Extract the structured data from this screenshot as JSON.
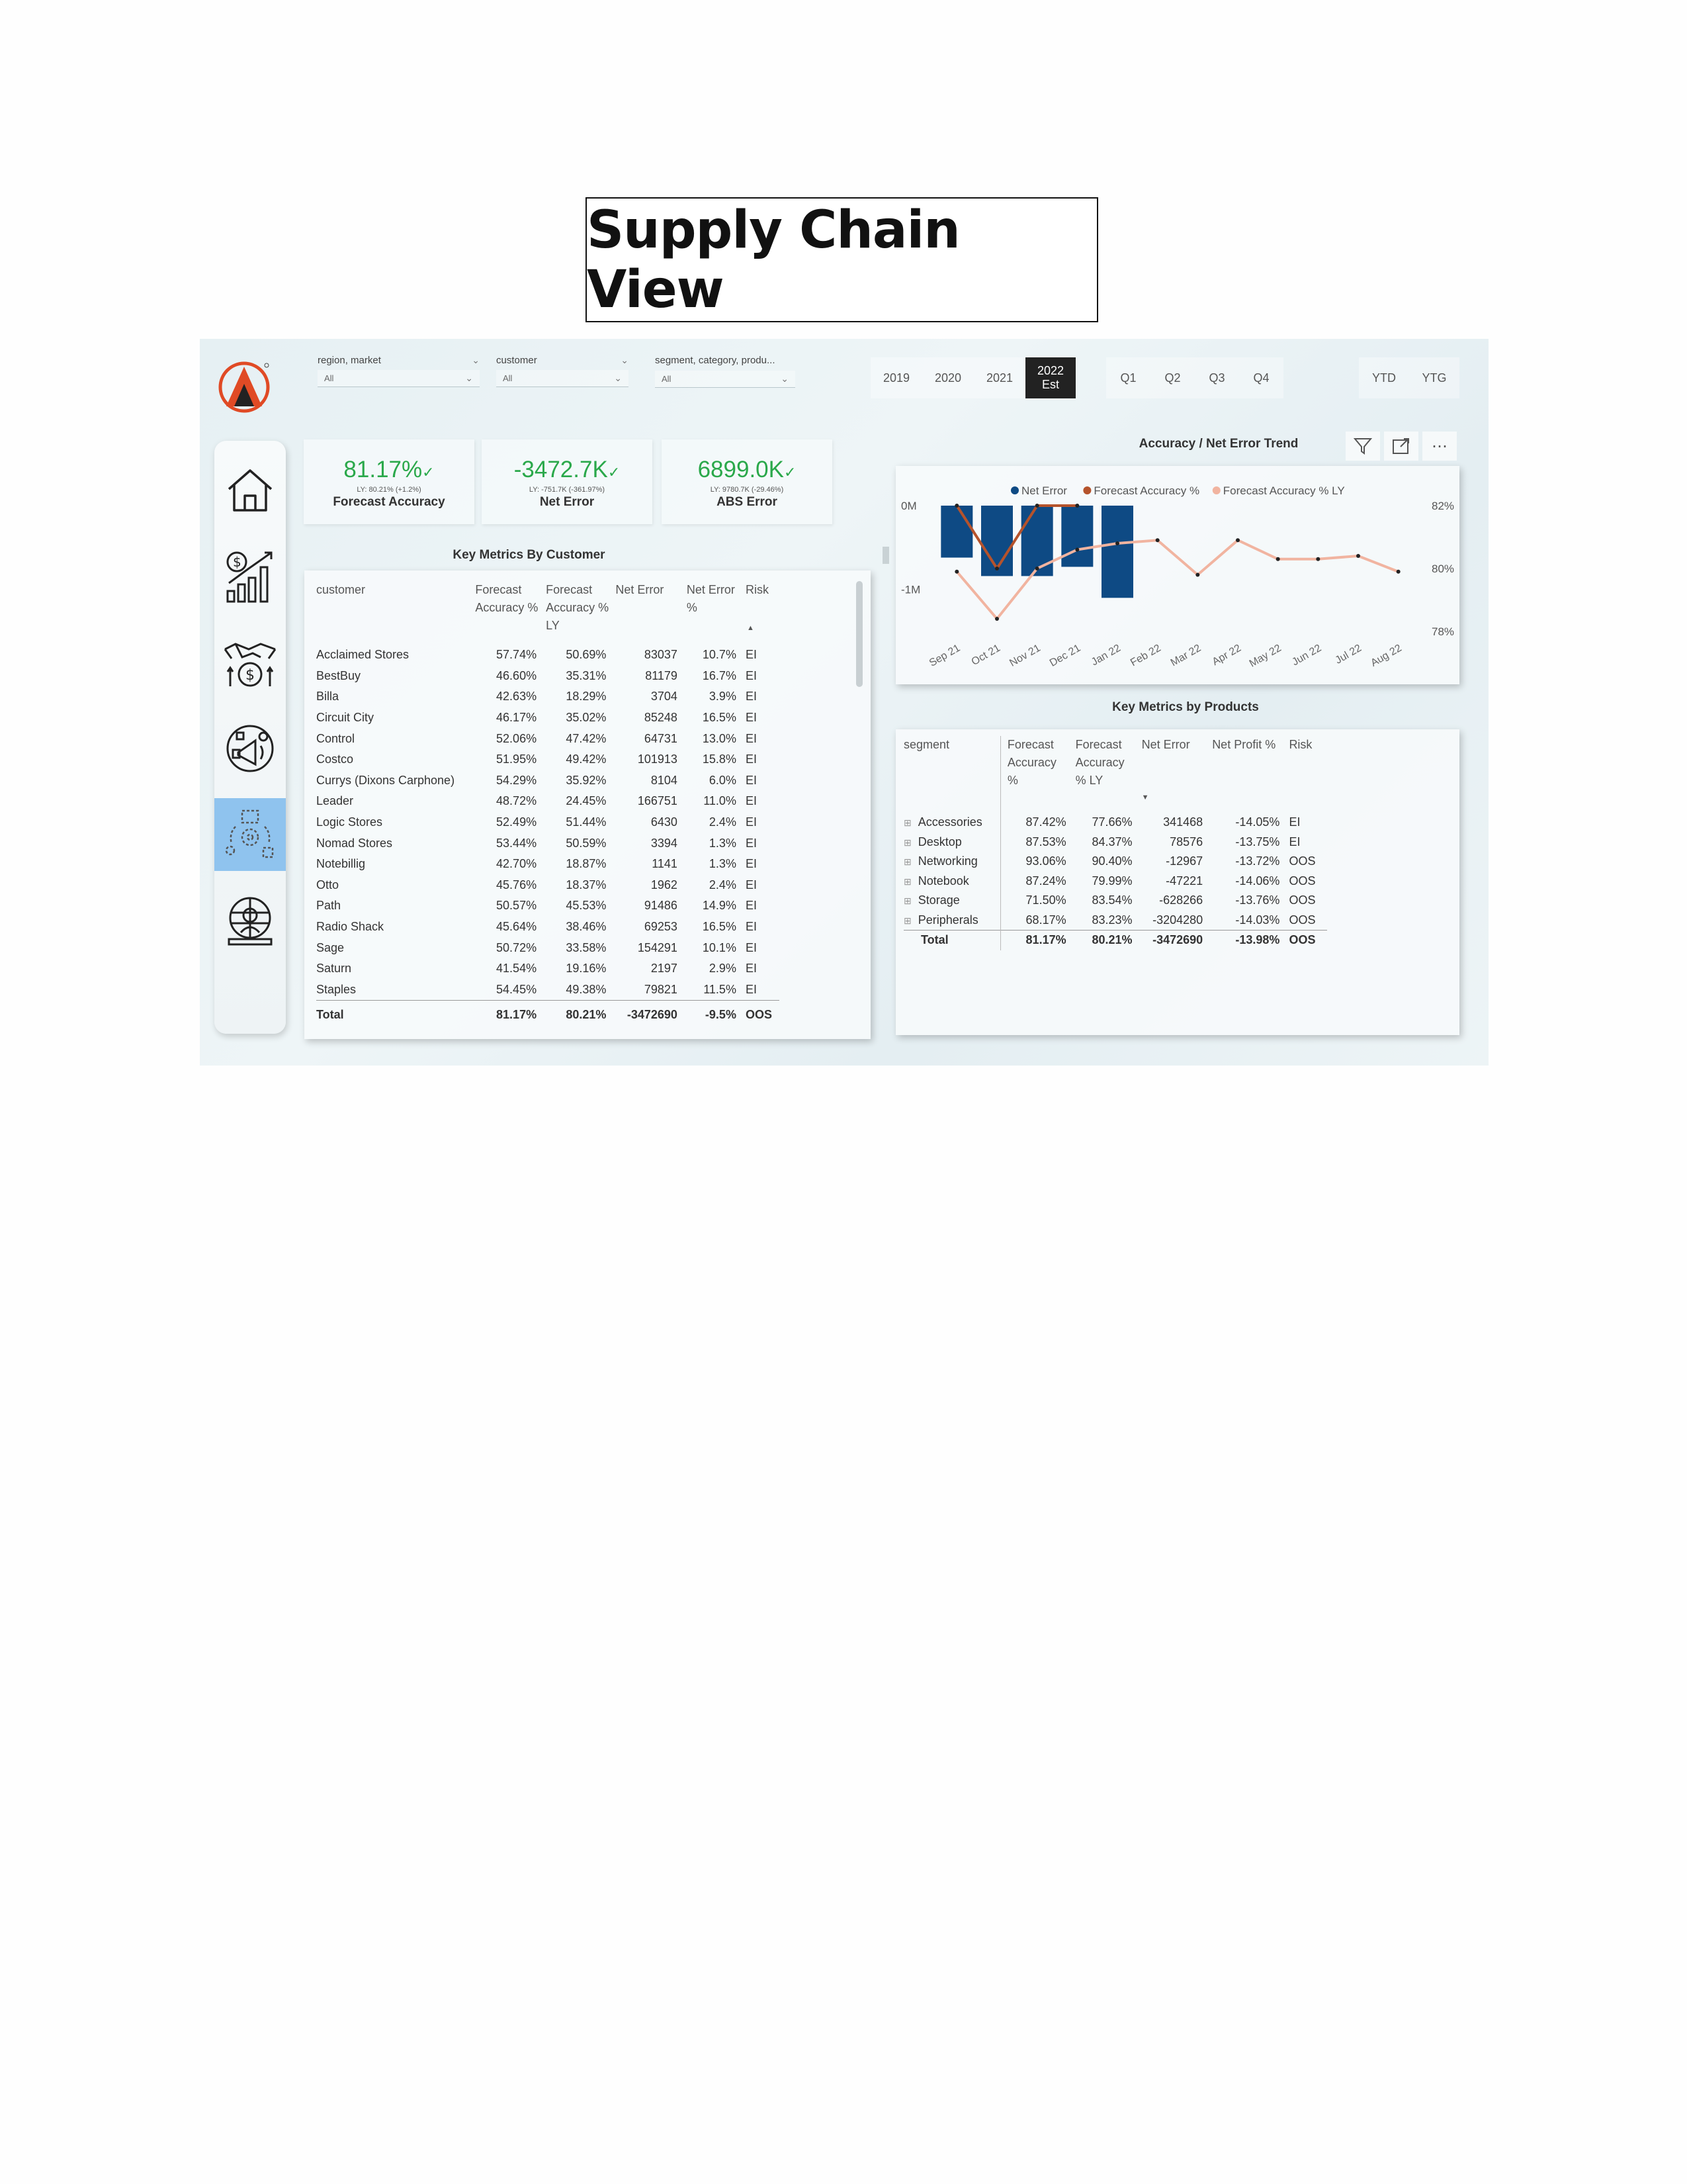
{
  "page_title": "Supply Chain View",
  "filters": {
    "region": {
      "label": "region, market",
      "value": "All"
    },
    "customer": {
      "label": "customer",
      "value": "All"
    },
    "segment": {
      "label": "segment, category, produ...",
      "value": "All"
    }
  },
  "years": [
    "2019",
    "2020",
    "2021"
  ],
  "selected_year": {
    "line1": "2022",
    "line2": "Est"
  },
  "quarters": [
    "Q1",
    "Q2",
    "Q3",
    "Q4"
  ],
  "periods": [
    "YTD",
    "YTG"
  ],
  "nav": [
    "home-icon",
    "sales-growth-icon",
    "finance-handshake-icon",
    "marketing-icon",
    "supply-chain-icon",
    "executive-icon"
  ],
  "kpis": [
    {
      "value": "81.17%",
      "ly": "LY: 80.21% (+1.2%)",
      "label": "Forecast Accuracy"
    },
    {
      "value": "-3472.7K",
      "ly": "LY: -751.7K (-361.97%)",
      "label": "Net Error"
    },
    {
      "value": "6899.0K",
      "ly": "LY: 9780.7K (-29.46%)",
      "label": "ABS Error"
    }
  ],
  "customer_table": {
    "title": "Key Metrics By Customer",
    "headers": [
      "customer",
      "Forecast Accuracy %",
      "Forecast Accuracy % LY",
      "Net Error",
      "Net Error %",
      "Risk"
    ],
    "rows": [
      [
        "Acclaimed Stores",
        "57.74%",
        "50.69%",
        "83037",
        "10.7%",
        "EI"
      ],
      [
        "BestBuy",
        "46.60%",
        "35.31%",
        "81179",
        "16.7%",
        "EI"
      ],
      [
        "Billa",
        "42.63%",
        "18.29%",
        "3704",
        "3.9%",
        "EI"
      ],
      [
        "Circuit City",
        "46.17%",
        "35.02%",
        "85248",
        "16.5%",
        "EI"
      ],
      [
        "Control",
        "52.06%",
        "47.42%",
        "64731",
        "13.0%",
        "EI"
      ],
      [
        "Costco",
        "51.95%",
        "49.42%",
        "101913",
        "15.8%",
        "EI"
      ],
      [
        "Currys (Dixons Carphone)",
        "54.29%",
        "35.92%",
        "8104",
        "6.0%",
        "EI"
      ],
      [
        "Leader",
        "48.72%",
        "24.45%",
        "166751",
        "11.0%",
        "EI"
      ],
      [
        "Logic Stores",
        "52.49%",
        "51.44%",
        "6430",
        "2.4%",
        "EI"
      ],
      [
        "Nomad Stores",
        "53.44%",
        "50.59%",
        "3394",
        "1.3%",
        "EI"
      ],
      [
        "Notebillig",
        "42.70%",
        "18.87%",
        "1141",
        "1.3%",
        "EI"
      ],
      [
        "Otto",
        "45.76%",
        "18.37%",
        "1962",
        "2.4%",
        "EI"
      ],
      [
        "Path",
        "50.57%",
        "45.53%",
        "91486",
        "14.9%",
        "EI"
      ],
      [
        "Radio Shack",
        "45.64%",
        "38.46%",
        "69253",
        "16.5%",
        "EI"
      ],
      [
        "Sage",
        "50.72%",
        "33.58%",
        "154291",
        "10.1%",
        "EI"
      ],
      [
        "Saturn",
        "41.54%",
        "19.16%",
        "2197",
        "2.9%",
        "EI"
      ],
      [
        "Staples",
        "54.45%",
        "49.38%",
        "79821",
        "11.5%",
        "EI"
      ]
    ],
    "total": [
      "Total",
      "81.17%",
      "80.21%",
      "-3472690",
      "-9.5%",
      "OOS"
    ]
  },
  "product_table": {
    "title": "Key Metrics by Products",
    "headers": [
      "segment",
      "Forecast Accuracy %",
      "Forecast Accuracy % LY",
      "Net Error",
      "Net Profit %",
      "Risk"
    ],
    "rows": [
      [
        "Accessories",
        "87.42%",
        "77.66%",
        "341468",
        "-14.05%",
        "EI"
      ],
      [
        "Desktop",
        "87.53%",
        "84.37%",
        "78576",
        "-13.75%",
        "EI"
      ],
      [
        "Networking",
        "93.06%",
        "90.40%",
        "-12967",
        "-13.72%",
        "OOS"
      ],
      [
        "Notebook",
        "87.24%",
        "79.99%",
        "-47221",
        "-14.06%",
        "OOS"
      ],
      [
        "Storage",
        "71.50%",
        "83.54%",
        "-628266",
        "-13.76%",
        "OOS"
      ],
      [
        "Peripherals",
        "68.17%",
        "83.23%",
        "-3204280",
        "-14.03%",
        "OOS"
      ]
    ],
    "total": [
      "Total",
      "81.17%",
      "80.21%",
      "-3472690",
      "-13.98%",
      "OOS"
    ]
  },
  "chart_title": "Accuracy / Net Error Trend",
  "chart_data": {
    "type": "bar",
    "title": "Accuracy / Net Error Trend",
    "categories": [
      "Sep 21",
      "Oct 21",
      "Nov 21",
      "Dec 21",
      "Jan 22",
      "Feb 22",
      "Mar 22",
      "Apr 22",
      "May 22",
      "Jun 22",
      "Jul 22",
      "Aug 22"
    ],
    "series": [
      {
        "name": "Net Error",
        "type": "bar",
        "color": "#0e4a84",
        "axis": "left",
        "values": [
          -0.62,
          -0.84,
          -0.84,
          -0.73,
          -1.1,
          null,
          null,
          null,
          null,
          null,
          null,
          null
        ]
      },
      {
        "name": "Forecast Accuracy %",
        "type": "line",
        "color": "#b5532c",
        "axis": "right",
        "values": [
          82.0,
          80.0,
          82.0,
          82.0,
          null,
          null,
          null,
          null,
          null,
          null,
          null,
          null
        ]
      },
      {
        "name": "Forecast Accuracy % LY",
        "type": "line",
        "color": "#f1b4a0",
        "axis": "right",
        "values": [
          79.9,
          78.4,
          80.0,
          80.6,
          80.8,
          80.9,
          79.8,
          80.9,
          80.3,
          80.3,
          80.4,
          79.9
        ]
      }
    ],
    "y_left": {
      "ticks": [
        "0M",
        "-1M"
      ],
      "min": -1.5,
      "max": 0.0
    },
    "y_right": {
      "ticks": [
        "82%",
        "80%",
        "78%"
      ],
      "min": 78,
      "max": 82
    },
    "legend_position": "top"
  }
}
